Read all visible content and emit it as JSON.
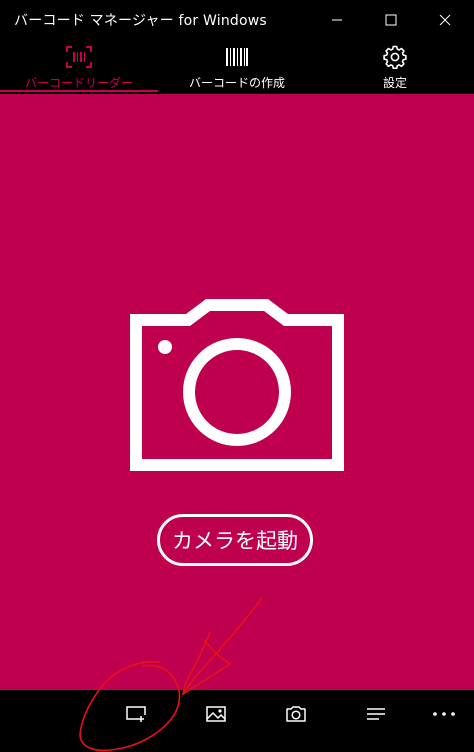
{
  "window": {
    "title": "バーコード マネージャー for Windows"
  },
  "tabs": [
    {
      "label": "バーコードリーダー",
      "icon": "barcode-scan-icon",
      "selected": true
    },
    {
      "label": "バーコードの作成",
      "icon": "barcode-icon",
      "selected": false
    },
    {
      "label": "設定",
      "icon": "gear-icon",
      "selected": false
    }
  ],
  "main": {
    "icon": "camera-icon",
    "start_button_label": "カメラを起動"
  },
  "appbar": {
    "buttons": [
      {
        "icon": "scan-region-icon"
      },
      {
        "icon": "image-icon"
      },
      {
        "icon": "camera-icon"
      },
      {
        "icon": "list-icon"
      },
      {
        "icon": "more-icon"
      }
    ]
  },
  "colors": {
    "accent": "#bf004f",
    "tab_selected": "#c8004f",
    "chrome_background": "#000000",
    "foreground": "#ffffff",
    "annotation_stroke": "#e8101a"
  }
}
